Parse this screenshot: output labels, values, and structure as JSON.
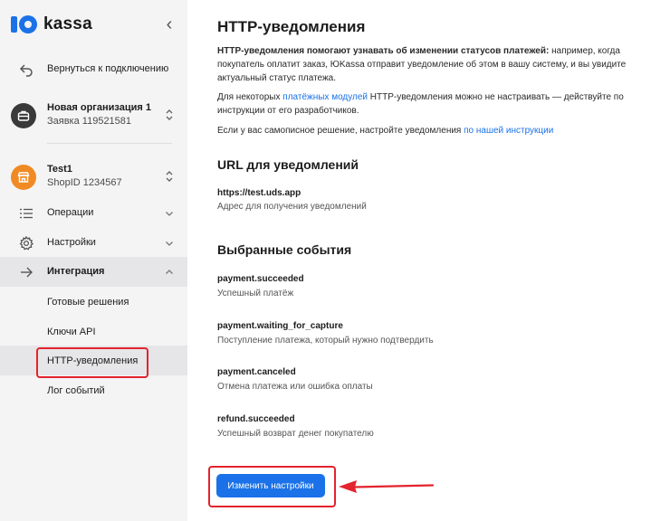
{
  "brand": {
    "name": "kassa",
    "accent": "#1b72e8",
    "highlight": "#e3232d"
  },
  "sidebar": {
    "back_label": "Вернуться к подключению",
    "org": {
      "title": "Новая организация 1",
      "subtitle": "Заявка 119521581"
    },
    "shop": {
      "title": "Test1",
      "subtitle": "ShopID 1234567"
    },
    "items": [
      {
        "label": "Операции",
        "icon": "list-icon"
      },
      {
        "label": "Настройки",
        "icon": "gear-icon"
      },
      {
        "label": "Интеграция",
        "icon": "arrow-right-icon"
      }
    ],
    "subitems": [
      {
        "label": "Готовые решения"
      },
      {
        "label": "Ключи API"
      },
      {
        "label": "HTTP-уведомления"
      },
      {
        "label": "Лог событий"
      }
    ]
  },
  "main": {
    "title": "HTTP-уведомления",
    "intro_bold": "HTTP-уведомления помогают узнавать об изменении статусов платежей:",
    "intro_rest": " например, когда покупатель оплатит заказ, ЮKassa отправит уведомление об этом в вашу систему, и вы увидите актуальный статус платежа.",
    "p2_before": "Для некоторых ",
    "p2_link": "платёжных модулей",
    "p2_after": " HTTP-уведомления можно не настраивать — действуйте по инструкции от его разработчиков.",
    "p3_before": "Если у вас самописное решение, настройте уведомления ",
    "p3_link": "по нашей инструкции",
    "url_section": {
      "title": "URL для уведомлений",
      "url": "https://test.uds.app",
      "desc": "Адрес для получения уведомлений"
    },
    "events_section": {
      "title": "Выбранные события",
      "events": [
        {
          "name": "payment.succeeded",
          "desc": "Успешный платёж"
        },
        {
          "name": "payment.waiting_for_capture",
          "desc": "Поступление платежа, который нужно подтвердить"
        },
        {
          "name": "payment.canceled",
          "desc": "Отмена платежа или ошибка оплаты"
        },
        {
          "name": "refund.succeeded",
          "desc": "Успешный возврат денег покупателю"
        }
      ]
    },
    "button_label": "Изменить настройки"
  }
}
